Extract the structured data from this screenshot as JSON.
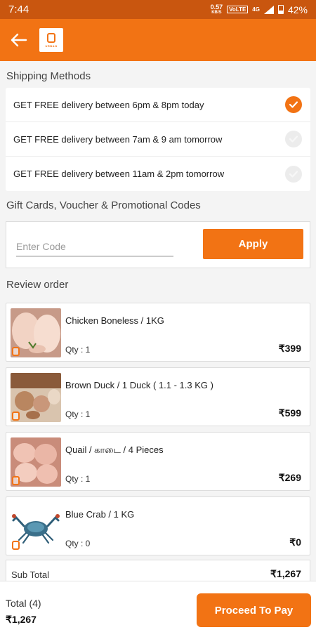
{
  "status_bar": {
    "time": "7:44",
    "net_speed": "0.57",
    "net_unit": "KB/S",
    "volte": "VoLTE",
    "network": "4G",
    "battery": "42%"
  },
  "header": {
    "back_icon": "arrow-left-icon",
    "logo": "brand-logo"
  },
  "shipping": {
    "title": "Shipping Methods",
    "options": [
      {
        "label": "GET FREE delivery between 6pm & 8pm today",
        "selected": true
      },
      {
        "label": "GET FREE delivery between 7am & 9 am tomorrow",
        "selected": false
      },
      {
        "label": "GET FREE delivery between 11am & 2pm  tomorrow",
        "selected": false
      }
    ]
  },
  "promo": {
    "title": "Gift Cards, Voucher & Promotional Codes",
    "placeholder": "Enter Code",
    "apply_label": "Apply"
  },
  "review": {
    "title": "Review order",
    "items": [
      {
        "name": "Chicken Boneless / 1KG",
        "qty": "Qty : 1",
        "price": "₹399",
        "thumb": "chicken-boneless"
      },
      {
        "name": "Brown Duck / 1 Duck ( 1.1 - 1.3 KG )",
        "qty": "Qty : 1",
        "price": "₹599",
        "thumb": "brown-duck"
      },
      {
        "name": "Quail / காடை / 4 Pieces",
        "qty": "Qty : 1",
        "price": "₹269",
        "thumb": "quail"
      },
      {
        "name": "Blue Crab / 1 KG",
        "qty": "Qty : 0",
        "price": "₹0",
        "thumb": "blue-crab"
      }
    ],
    "subtotal_label": "Sub Total",
    "subtotal_value": "₹1,267"
  },
  "footer": {
    "total_label": "Total (4)",
    "total_value": "₹1,267",
    "pay_label": "Proceed To Pay"
  },
  "colors": {
    "brand": "#f27314",
    "status_bar": "#c9560f"
  }
}
